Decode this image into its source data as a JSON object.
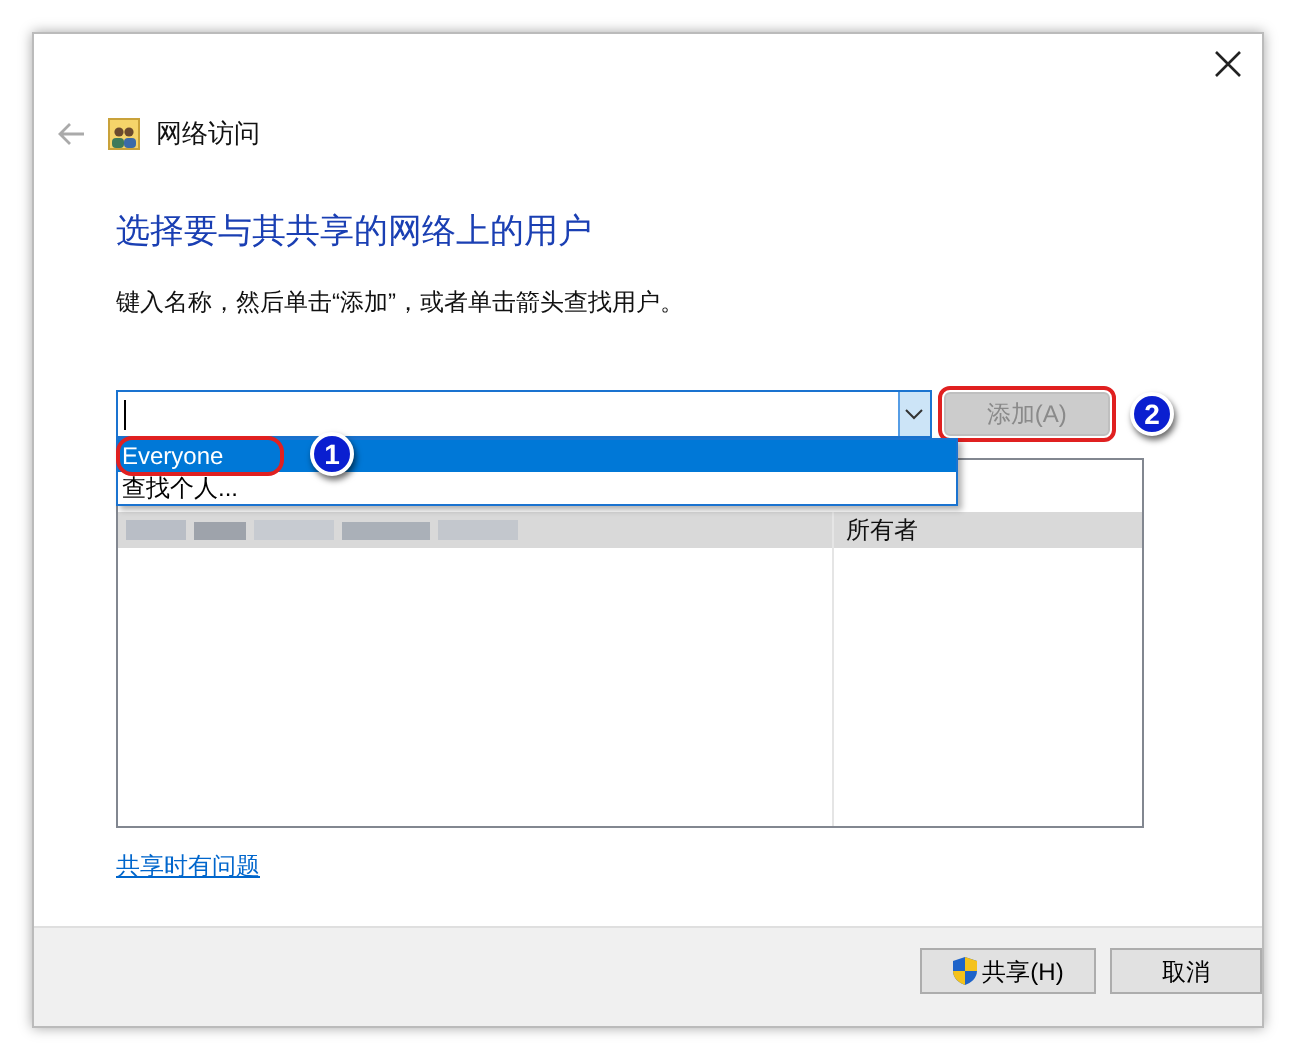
{
  "window": {
    "title": "网络访问"
  },
  "heading": "选择要与其共享的网络上的用户",
  "instruction": "键入名称，然后单击“添加”，或者单击箭头查找用户。",
  "dropdown": {
    "expanded": true,
    "options": [
      {
        "label": "Everyone",
        "selected": true
      },
      {
        "label": "查找个人...",
        "selected": false
      }
    ]
  },
  "add_button": {
    "label": "添加(A)",
    "disabled": true
  },
  "callouts": [
    {
      "label": "1"
    },
    {
      "label": "2"
    }
  ],
  "users": [
    {
      "permission": "所有者",
      "selected": true
    }
  ],
  "help_link": "共享时有问题",
  "buttons": [
    {
      "label": "共享(H)",
      "kind": "shield"
    },
    {
      "label": "取消",
      "kind": "plain"
    }
  ]
}
